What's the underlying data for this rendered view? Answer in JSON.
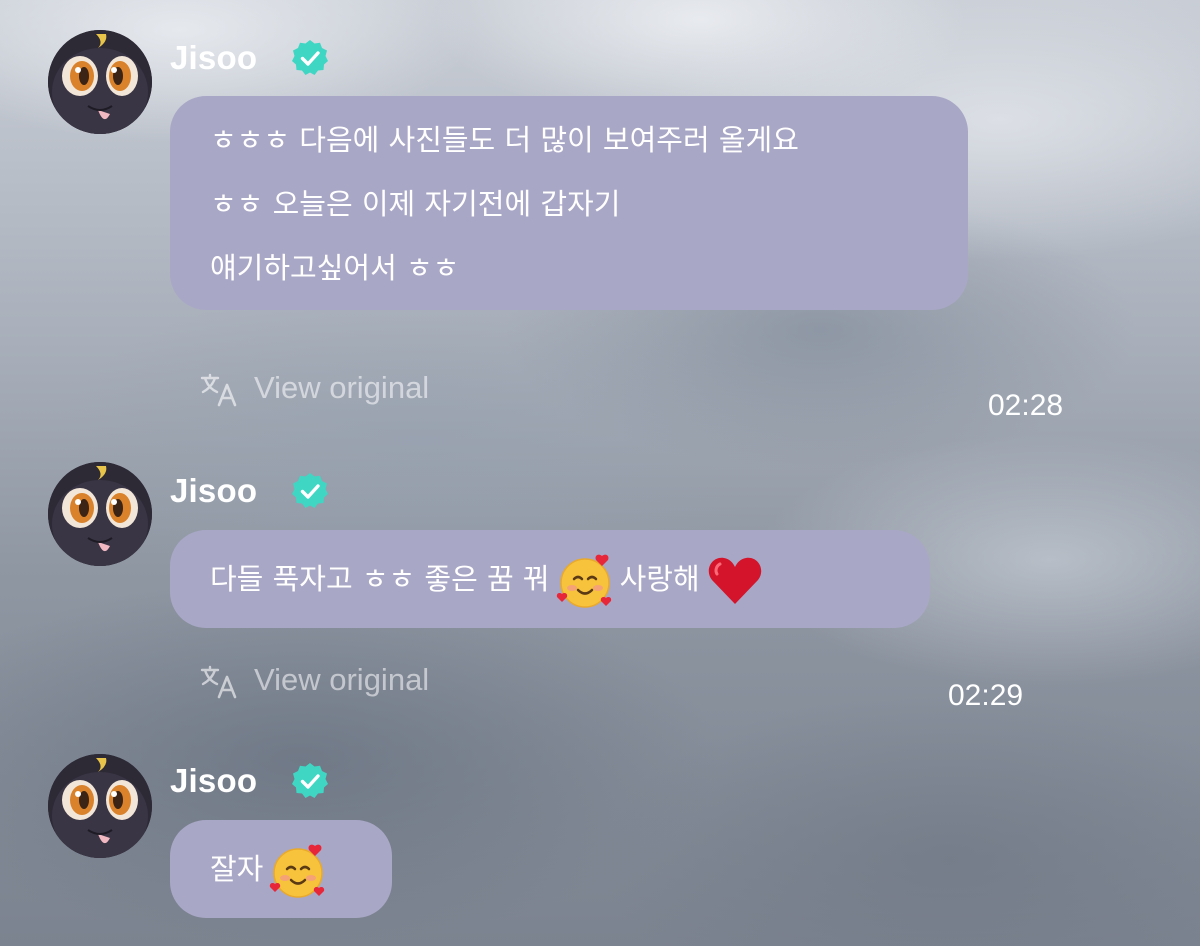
{
  "colors": {
    "bubble": "#a9a7c6",
    "verified": "#3fd6c3",
    "text": "#ffffff"
  },
  "messages": [
    {
      "sender": "Jisoo",
      "verified_icon": "verified-badge-icon",
      "lines": [
        "ㅎㅎㅎ 다음에 사진들도 더 많이 보여주러 올게요",
        "ㅎㅎ 오늘은 이제 자기전에 갑자기",
        "얘기하고싶어서 ㅎㅎ"
      ],
      "translate_label": "View original",
      "time": "02:28"
    },
    {
      "sender": "Jisoo",
      "verified_icon": "verified-badge-icon",
      "text_parts": [
        "다들 푹자고 ㅎㅎ 좋은 꿈 꿔",
        "사랑해"
      ],
      "emojis": [
        "smiling-face-with-hearts-emoji",
        "red-heart-emoji"
      ],
      "translate_label": "View original",
      "time": "02:29"
    },
    {
      "sender": "Jisoo",
      "verified_icon": "verified-badge-icon",
      "text_parts": [
        "잘자"
      ],
      "emojis": [
        "smiling-face-with-hearts-emoji"
      ]
    }
  ]
}
